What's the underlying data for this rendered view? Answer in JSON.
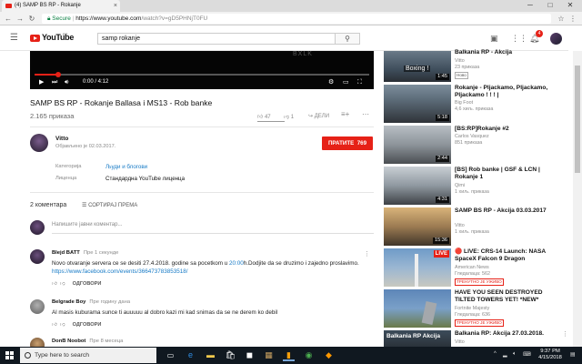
{
  "browser": {
    "tab_title": "(4) SAMP BS RP - Rokanje",
    "tab_close": "×",
    "url_secure_label": "Secure",
    "url_host": "https://www.youtube.com",
    "url_path": "/watch?v=gD5PHNjT0FU",
    "win_min": "─",
    "win_max": "□",
    "win_close": "✕"
  },
  "youtube": {
    "logo_text": "YouTube",
    "logo_region": "RS",
    "search_value": "samp rokanje",
    "notifications_count": "4"
  },
  "player": {
    "time": "0:00 / 4:12",
    "watermark": "BXLK",
    "progress_fraction": 0.07
  },
  "video": {
    "title": "SAMP BS RP - Rokanje Ballasa i MS13 - Rob banke",
    "views": "2.165 приказа",
    "likes": "47",
    "dislikes": "1",
    "share_label": "ДЕЛИ"
  },
  "channel": {
    "name": "Vitto",
    "published": "Објављено је 02.03.2017.",
    "subscribe_label": "ПРАТИТЕ",
    "subscribe_count": "769",
    "category_label": "Категорија",
    "category_value": "Људи и блогови",
    "license_label": "Лиценца",
    "license_value": "Стандардна YouTube лиценца"
  },
  "comments": {
    "count_label": "2 коментара",
    "sort_label": "СОРТИРАЈ ПРЕМА",
    "add_placeholder": "Напишите јавни коментар...",
    "items": [
      {
        "author": "Blejd BATT",
        "time": "Пре 1 секунде",
        "text_1": "Novo otvaranje servera ce se desiti 27.4.2018. godine sa pocetkom u ",
        "text_time": "20:00",
        "text_2": "h.Dodjite da se druzimo i zajedno proslavimo.",
        "link": "https://www.facebook.com/events/366473783853518/",
        "reply": "ОДГОВОРИ"
      },
      {
        "author": "Belgrade Boy",
        "time": "Пре годину дана",
        "text_1": "Al masis kuburama sunce ti auuuuu al dobro kazi mi kad snimas da se ne derem ko debil",
        "reply": "ОДГОВОРИ"
      },
      {
        "author": "DonB Noobot",
        "time": "Пре 8 месеца"
      }
    ]
  },
  "related": [
    {
      "title": "Balkania RP - Akcija",
      "channel": "Vitto",
      "views": "23 приказа",
      "badge": "Ново",
      "duration": "1:45",
      "thumb_text": "Boxing !"
    },
    {
      "title": "Rokanje - Pljackamo, Pljackamo, Pljackamo ! ! ! |",
      "channel": "Big Foot",
      "views": "4,6 хиљ. приказа",
      "duration": "5:18"
    },
    {
      "title": "[BS:RP]Rokanje #2",
      "channel": "Carlos Vasquez",
      "views": "851 приказа",
      "duration": "2:44"
    },
    {
      "title": "[BS] Rob banke | GSF & LCN | Rokanje 1",
      "channel": "Qimi",
      "views": "1 хиљ. приказа",
      "duration": "4:31"
    },
    {
      "title": "SAMP BS RP - Akcija 03.03.2017",
      "channel": "Vitto",
      "views": "1 хиљ. приказа",
      "duration": "15:36"
    },
    {
      "title": "🔴 LIVE: CRS-14 Launch: NASA SpaceX Falcon 9 Dragon",
      "channel": "American News",
      "views": "Гледалаца: 562",
      "live": "ТРЕНУТНО ЈЕ УЖИВО",
      "thumb_text": "LIVE"
    },
    {
      "title": "HAVE YOU SEEN DESTROYED TILTED TOWERS YET! *NEW*",
      "channel": "Fortnite Majesty",
      "views": "Гледалаца: 636",
      "live": "ТРЕНУТНО ЈЕ УЖИВО"
    },
    {
      "title": "Balkania RP: Akcija 27.03.2018.",
      "channel": "Vitto",
      "thumb_text": "Balkania RP Akcija"
    }
  ],
  "taskbar": {
    "search_placeholder": "Type here to search",
    "time": "9:37 PM",
    "date": "4/15/2018"
  },
  "colors": {
    "accent": "#e62117",
    "link": "#167ac6"
  }
}
